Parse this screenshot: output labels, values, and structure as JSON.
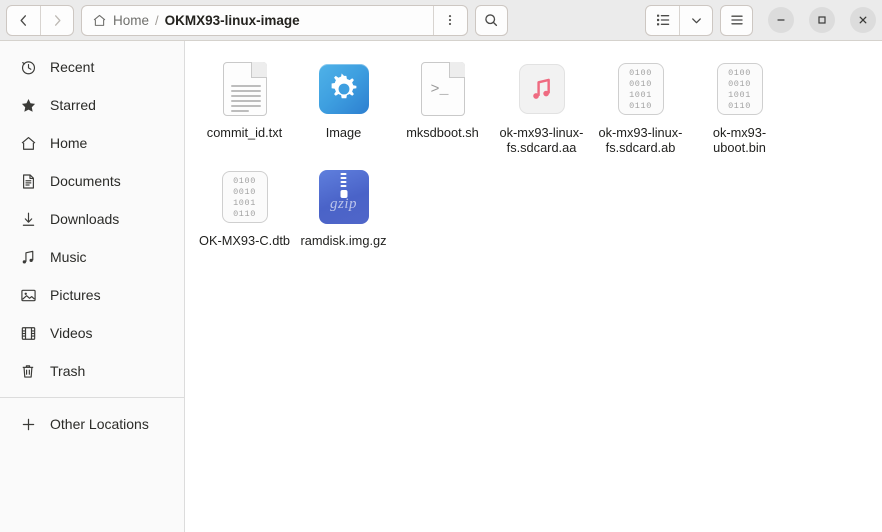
{
  "window": {
    "minimize_label": "–",
    "maximize_label": "□",
    "close_label": "✕"
  },
  "toolbar": {
    "back_label": "‹",
    "forward_label": "›",
    "path_menu_label": "⋮",
    "search_label": "search-icon",
    "view_list_label": "list-view-icon",
    "view_chevron_label": "˅",
    "app_menu_label": "hamburger-menu-icon"
  },
  "breadcrumb": {
    "home_label": "Home",
    "separator": "/",
    "current_label": "OKMX93-linux-image"
  },
  "sidebar": {
    "items": [
      {
        "label": "Recent",
        "icon": "clock-icon"
      },
      {
        "label": "Starred",
        "icon": "star-icon"
      },
      {
        "label": "Home",
        "icon": "home-icon"
      },
      {
        "label": "Documents",
        "icon": "document-icon"
      },
      {
        "label": "Downloads",
        "icon": "download-icon"
      },
      {
        "label": "Music",
        "icon": "music-note-icon"
      },
      {
        "label": "Pictures",
        "icon": "picture-icon"
      },
      {
        "label": "Videos",
        "icon": "video-icon"
      },
      {
        "label": "Trash",
        "icon": "trash-icon"
      }
    ],
    "other_locations": {
      "label": "Other Locations",
      "icon": "plus-icon"
    }
  },
  "files": [
    {
      "name": "commit_id.txt",
      "type": "text",
      "icon": "text-file-icon"
    },
    {
      "name": "Image",
      "type": "app",
      "icon": "gear-app-icon"
    },
    {
      "name": "mksdboot.sh",
      "type": "script",
      "icon": "script-file-icon",
      "glyph": ">_"
    },
    {
      "name": "ok-mx93-linux-fs.sdcard.aa",
      "type": "audio",
      "icon": "audio-file-icon"
    },
    {
      "name": "ok-mx93-linux-fs.sdcard.ab",
      "type": "binary",
      "icon": "binary-file-icon"
    },
    {
      "name": "ok-mx93-uboot.bin",
      "type": "binary",
      "icon": "binary-file-icon"
    },
    {
      "name": "OK-MX93-C.dtb",
      "type": "binary",
      "icon": "binary-file-icon"
    },
    {
      "name": "ramdisk.img.gz",
      "type": "archive",
      "icon": "gzip-archive-icon",
      "glyph": "gzip"
    }
  ],
  "binary_icon_rows": [
    "0100",
    "0010",
    "1001",
    "0110"
  ],
  "colors": {
    "headerbar": "#ebebeb",
    "sidebar": "#fafafa",
    "content": "#ffffff",
    "accent_blue": "#3e9fe0",
    "archive_blue": "#4a63c8",
    "audio_pink": "#ef6b81",
    "text": "#1f1f1d"
  }
}
